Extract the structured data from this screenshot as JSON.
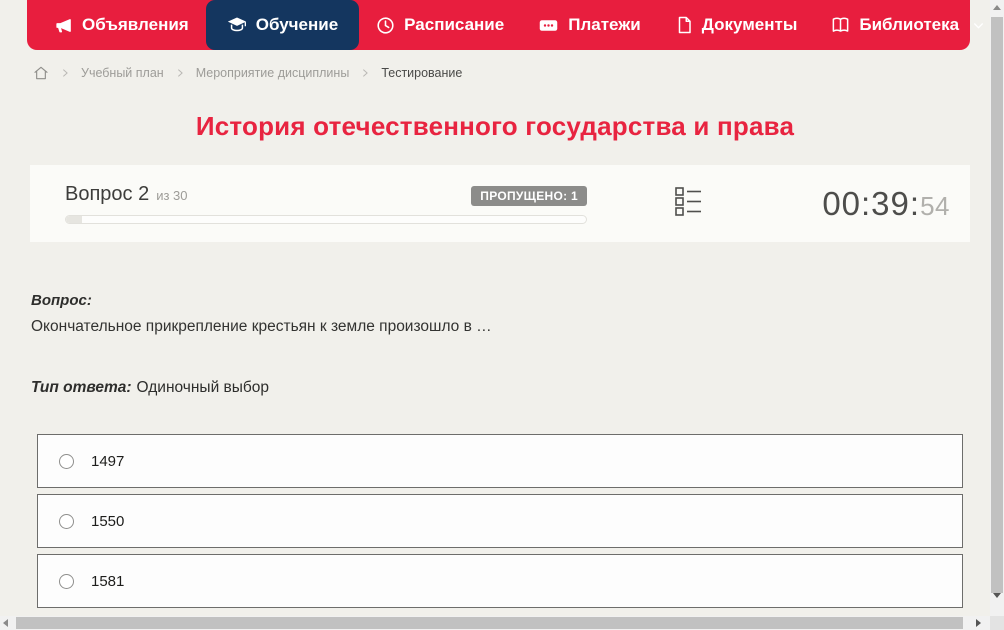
{
  "nav": {
    "items": [
      {
        "label": "Объявления",
        "icon": "megaphone-icon",
        "active": false
      },
      {
        "label": "Обучение",
        "icon": "graduation-cap-icon",
        "active": true
      },
      {
        "label": "Расписание",
        "icon": "clock-icon",
        "active": false
      },
      {
        "label": "Платежи",
        "icon": "payments-icon",
        "active": false
      },
      {
        "label": "Документы",
        "icon": "document-icon",
        "active": false
      },
      {
        "label": "Библиотека",
        "icon": "book-icon",
        "active": false,
        "has_dropdown": true
      }
    ],
    "colors": {
      "bar": "#e81e3e",
      "active_item": "#14365f"
    }
  },
  "breadcrumb": {
    "items": [
      {
        "label": "Учебный план"
      },
      {
        "label": "Мероприятие дисциплины"
      },
      {
        "label": "Тестирование"
      }
    ]
  },
  "page": {
    "title": "История отечественного государства и права",
    "title_color": "#e82440"
  },
  "quiz": {
    "question_number": "Вопрос 2",
    "question_of": "из 30",
    "skipped_badge": "ПРОПУЩЕНО: 1",
    "progress_percent": 3,
    "timer_hhmm": "00:39",
    "timer_colon": ":",
    "timer_seconds": "54",
    "question_label": "Вопрос:",
    "question_text": "Окончательное прикрепление крестьян к земле произошло в …",
    "answer_type_label": "Тип ответа:",
    "answer_type_value": "Одиночный выбор",
    "options": [
      {
        "label": "1497"
      },
      {
        "label": "1550"
      },
      {
        "label": "1581"
      }
    ]
  }
}
